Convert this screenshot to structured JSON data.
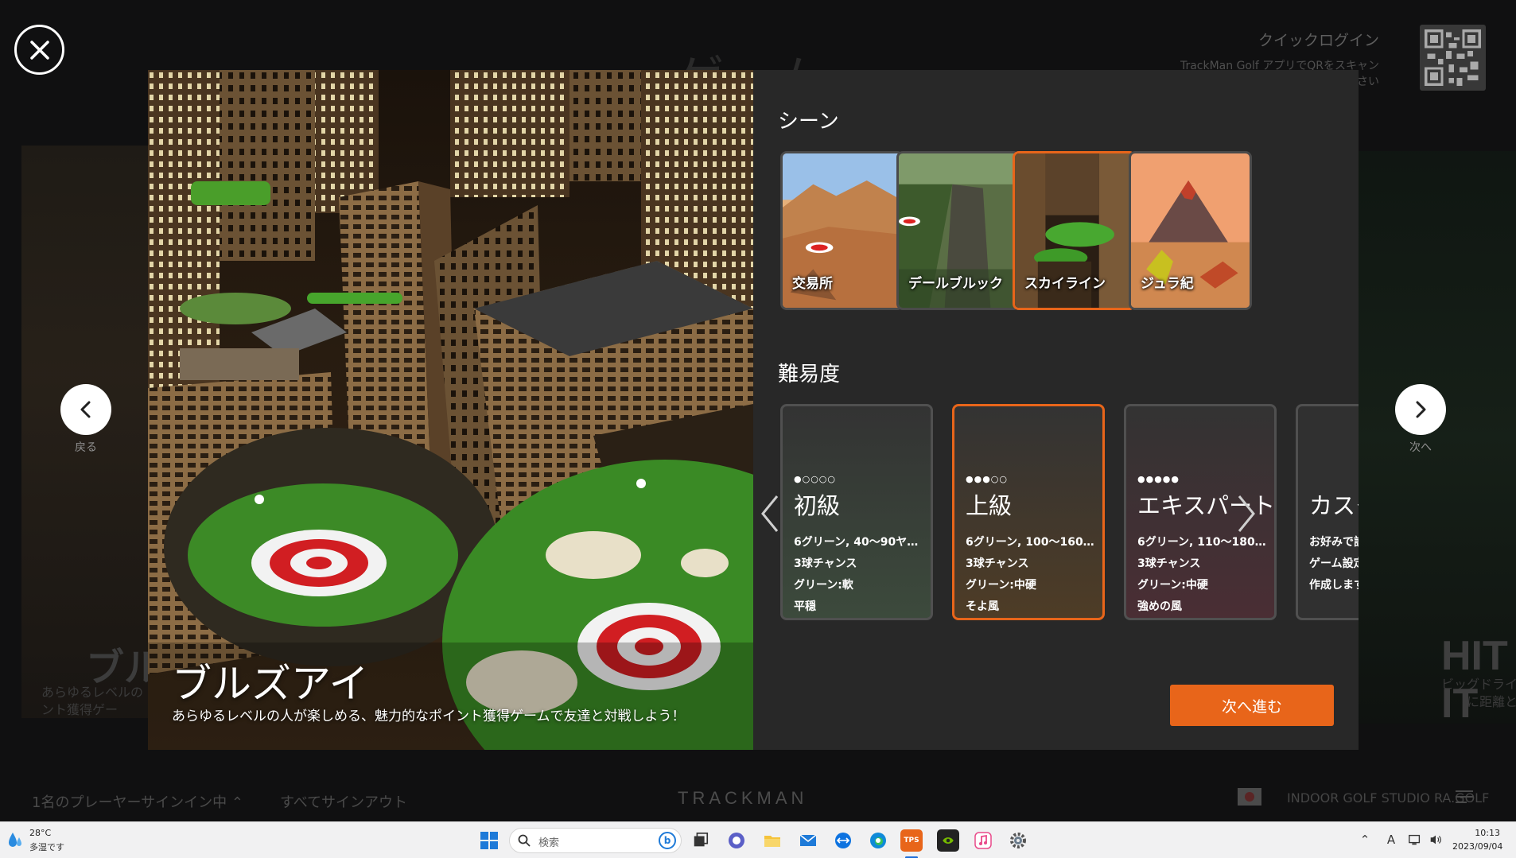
{
  "background": {
    "page_title": "ゲーム",
    "left_card_title": "ブル",
    "left_card_desc": "あらゆるレベルの イント獲得ゲー",
    "right_card_title": "HIT IT",
    "right_card_desc": "ビッグドライ に距離と"
  },
  "quick_login": {
    "title": "クイックログイン",
    "subtitle": "TrackMan Golf アプリでQRをスキャンしてください"
  },
  "nav": {
    "prev_label": "戻る",
    "next_label": "次へ"
  },
  "game": {
    "title": "ブルズアイ",
    "description": "あらゆるレベルの人が楽しめる、魅力的なポイント獲得ゲームで友達と対戦しよう！"
  },
  "scene_section": {
    "title": "シーン",
    "scenes": [
      {
        "label": "交易所",
        "selected": false
      },
      {
        "label": "デールブルック",
        "selected": false
      },
      {
        "label": "スカイライン",
        "selected": true
      },
      {
        "label": "ジュラ紀",
        "selected": false
      }
    ]
  },
  "difficulty_section": {
    "title": "難易度",
    "levels": [
      {
        "dots": "●○○○○",
        "name": "初級",
        "lines": [
          "6グリーン, 40〜90ヤ…",
          "3球チャンス",
          "グリーン:軟",
          "平穏"
        ],
        "selected": false
      },
      {
        "dots": "●●●○○",
        "name": "上級",
        "lines": [
          "6グリーン, 100〜160…",
          "3球チャンス",
          "グリーン:中硬",
          "そよ風"
        ],
        "selected": true
      },
      {
        "dots": "●●●●●",
        "name": "エキスパート",
        "lines": [
          "6グリーン, 110〜180…",
          "3球チャンス",
          "グリーン:中硬",
          "強めの風"
        ],
        "selected": false
      },
      {
        "dots": "",
        "name": "カスタム",
        "lines": [
          "お好みで設",
          "ゲーム設定",
          "作成します"
        ],
        "selected": false
      }
    ]
  },
  "next_button_label": "次へ進む",
  "footer": {
    "signin_status": "1名のプレーヤーサインイン中",
    "signout_all": "すべてサインアウト",
    "brand": "TRACKMAN",
    "studio": "INDOOR GOLF STUDIO RA.GOLF"
  },
  "taskbar": {
    "weather_temp": "28°C",
    "weather_desc": "多湿です",
    "search_placeholder": "検索",
    "time": "10:13",
    "date": "2023/09/04",
    "ime": "A"
  },
  "colors": {
    "accent": "#e8651a",
    "panel_bg": "#282828"
  }
}
